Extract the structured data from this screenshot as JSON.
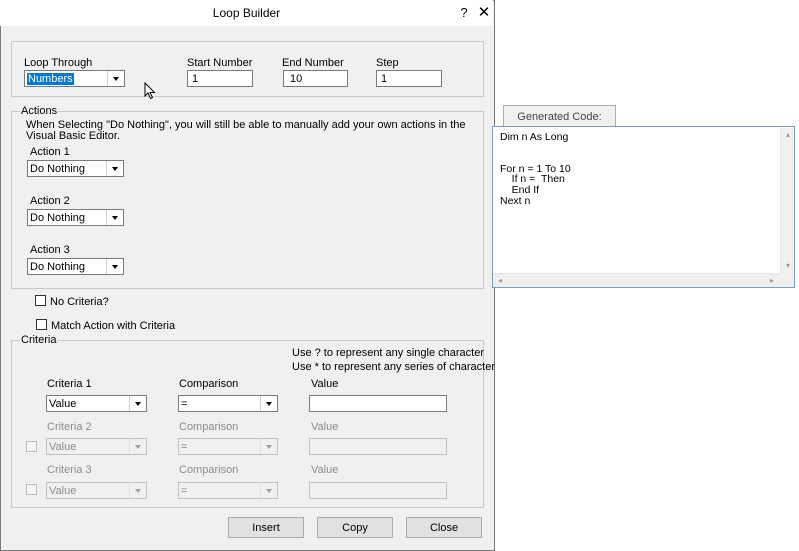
{
  "window": {
    "title": "Loop Builder",
    "help_glyph": "?",
    "close_glyph": "✕"
  },
  "loop": {
    "through_label": "Loop Through",
    "through_value": "Numbers",
    "start_label": "Start Number",
    "start_value": "1",
    "end_label": "End Number",
    "end_value": "10",
    "step_label": "Step",
    "step_value": "1"
  },
  "actions": {
    "group_label": "Actions",
    "note": "When Selecting \"Do Nothing\", you will still be able to manually add your own actions in the Visual Basic Editor.",
    "items": [
      {
        "label": "Action 1",
        "value": "Do Nothing"
      },
      {
        "label": "Action 2",
        "value": "Do Nothing"
      },
      {
        "label": "Action 3",
        "value": "Do Nothing"
      }
    ]
  },
  "options": {
    "no_criteria": "No Criteria?",
    "match_action": "Match Action with Criteria"
  },
  "criteria": {
    "group_label": "Criteria",
    "hint1": "Use ? to represent any single character",
    "hint2": "Use * to represent any series of characters",
    "rows": [
      {
        "label": "Criteria 1",
        "comparison_label": "Comparison",
        "value_label": "Value",
        "criteria_value": "Value",
        "comparison_value": "=",
        "enabled": true
      },
      {
        "label": "Criteria 2",
        "comparison_label": "Comparison",
        "value_label": "Value",
        "criteria_value": "Value",
        "comparison_value": "=",
        "enabled": false
      },
      {
        "label": "Criteria 3",
        "comparison_label": "Comparison",
        "value_label": "Value",
        "criteria_value": "Value",
        "comparison_value": "=",
        "enabled": false
      }
    ]
  },
  "buttons": {
    "insert": "Insert",
    "copy": "Copy",
    "close": "Close"
  },
  "generated": {
    "tab_label": "Generated Code:",
    "code": "Dim n As Long\n\n\nFor n = 1 To 10\n    If n =  Then\n    End If\nNext n"
  },
  "icons": {
    "arrow_left": "◂",
    "arrow_right": "▸",
    "arrow_up": "▴",
    "arrow_down": "▾"
  },
  "colors": {
    "accent": "#0078d7",
    "dialog_bg": "#f0f0f0",
    "border": "#7a7a7a"
  }
}
